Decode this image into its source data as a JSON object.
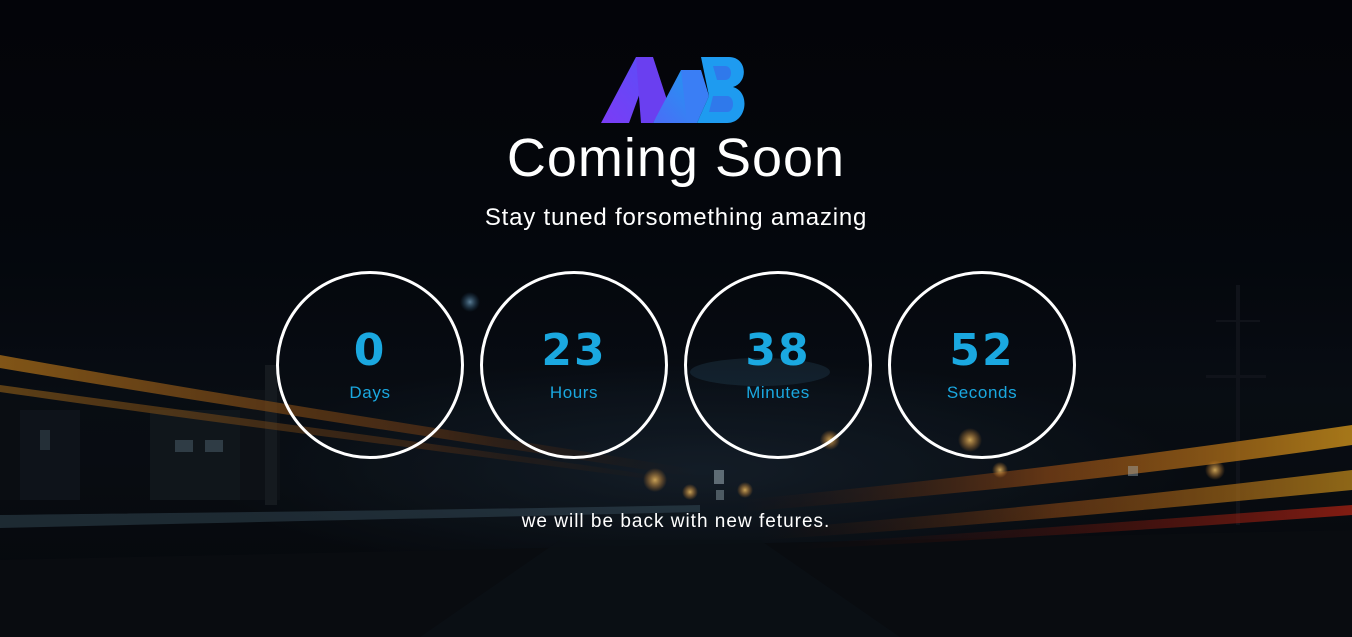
{
  "page": {
    "title": "Coming Soon",
    "subtitle": "Stay tuned forsomething amazing",
    "footer_text": "we will be back with new fetures."
  },
  "logo": {
    "icon": "mb-logo-icon",
    "colors": [
      "#7b3cf5",
      "#4b6cf7",
      "#1e9bf0"
    ]
  },
  "countdown": {
    "units": [
      {
        "value": "0",
        "label": "Days"
      },
      {
        "value": "23",
        "label": "Hours"
      },
      {
        "value": "38",
        "label": "Minutes"
      },
      {
        "value": "52",
        "label": "Seconds"
      }
    ]
  },
  "colors": {
    "accent": "#1aa8e0",
    "ring": "#ffffff",
    "text": "#ffffff",
    "background": "#05070d"
  }
}
